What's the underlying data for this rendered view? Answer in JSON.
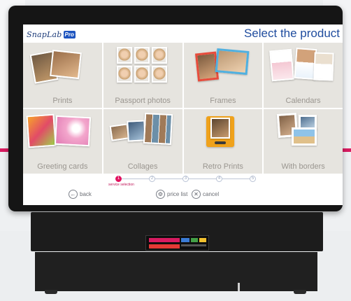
{
  "header": {
    "logo_text": "SnapLab",
    "logo_badge": "Pro",
    "title": "Select the product"
  },
  "products": [
    {
      "label": "Prints",
      "icon": "prints-photo-icon"
    },
    {
      "label": "Passport photos",
      "icon": "passport-photo-icon"
    },
    {
      "label": "Frames",
      "icon": "frames-photo-icon"
    },
    {
      "label": "Calendars",
      "icon": "calendar-photo-icon"
    },
    {
      "label": "Greeting cards",
      "icon": "greeting-card-icon"
    },
    {
      "label": "Collages",
      "icon": "collage-photo-icon"
    },
    {
      "label": "Retro Prints",
      "icon": "retro-print-icon"
    },
    {
      "label": "With borders",
      "icon": "bordered-photo-icon"
    }
  ],
  "progress": {
    "steps": [
      "1",
      "2",
      "3",
      "4",
      "5"
    ],
    "current_step": 1,
    "caption": "service selection"
  },
  "footer": {
    "back_label": "back",
    "price_list_label": "price list",
    "cancel_label": "cancel"
  },
  "colors": {
    "accent": "#e2115f",
    "title_blue": "#1f4c9e",
    "tile_bg": "#e6e4df"
  }
}
